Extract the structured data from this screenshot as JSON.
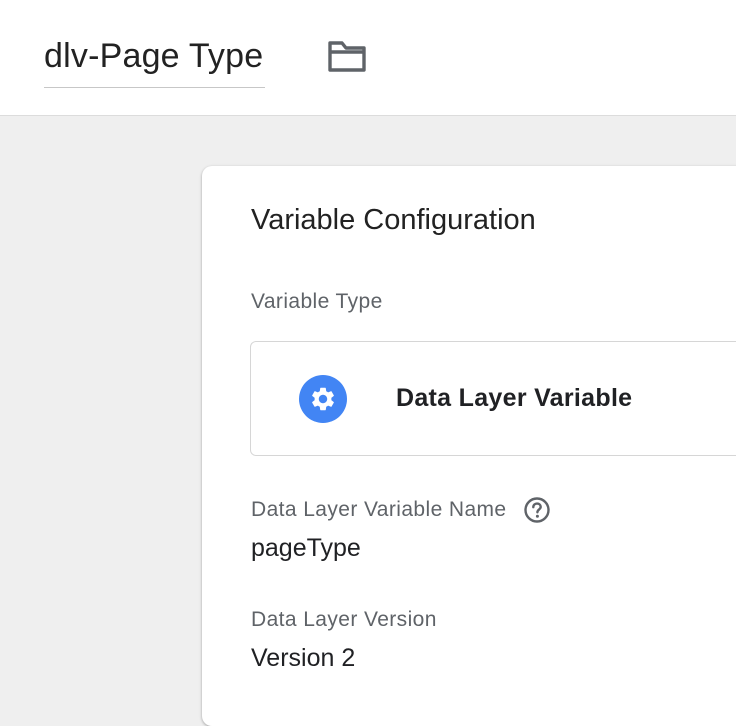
{
  "header": {
    "title": "dlv-Page Type",
    "folder_icon": "folder-icon"
  },
  "config": {
    "heading": "Variable Configuration",
    "variable_type_label": "Variable Type",
    "variable_type": {
      "name": "Data Layer Variable",
      "icon": "gear-icon",
      "icon_color": "#4285f4"
    },
    "dl_name_label": "Data Layer Variable Name",
    "dl_name_help_icon": "help-circle-icon",
    "dl_name_value": "pageType",
    "dl_version_label": "Data Layer Version",
    "dl_version_value": "Version 2"
  },
  "colors": {
    "background": "#efefef",
    "card": "#ffffff",
    "label": "#5f6368",
    "accent": "#4285f4"
  }
}
